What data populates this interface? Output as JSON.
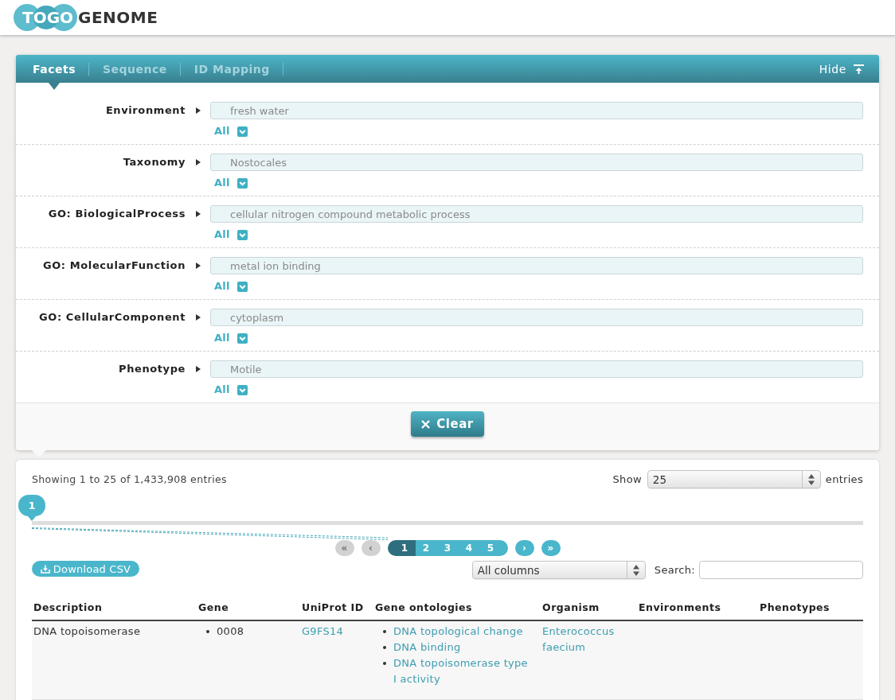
{
  "header": {
    "logo_mark": "TOGO",
    "logo_name": "GENOME"
  },
  "search_panel": {
    "tabs": [
      {
        "label": "Facets",
        "selected": true
      },
      {
        "label": "Sequence",
        "selected": false
      },
      {
        "label": "ID Mapping",
        "selected": false
      }
    ],
    "hide_button": "Hide",
    "facets": [
      {
        "label": "Environment",
        "placeholder": "fresh water",
        "filter": "All"
      },
      {
        "label": "Taxonomy",
        "placeholder": "Nostocales",
        "filter": "All"
      },
      {
        "label": "GO: BiologicalProcess",
        "placeholder": "cellular nitrogen compound metabolic process",
        "filter": "All"
      },
      {
        "label": "GO: MolecularFunction",
        "placeholder": "metal ion binding",
        "filter": "All"
      },
      {
        "label": "GO: CellularComponent",
        "placeholder": "cytoplasm",
        "filter": "All"
      },
      {
        "label": "Phenotype",
        "placeholder": "Motile",
        "filter": "All"
      }
    ],
    "clear_button": "Clear"
  },
  "results": {
    "summary": "Showing 1 to 25 of 1,433,908 entries",
    "show_label": "Show",
    "page_size": "25",
    "entries_label": "entries",
    "page_slider": {
      "handle": "1",
      "level": 0
    },
    "pagination": {
      "first": {
        "label": "«",
        "disabled": true
      },
      "previous": {
        "label": "‹",
        "disabled": true
      },
      "pages": [
        {
          "label": "1",
          "selected": true
        },
        {
          "label": "2",
          "selected": false
        },
        {
          "label": "3",
          "selected": false
        },
        {
          "label": "4",
          "selected": false
        },
        {
          "label": "5",
          "selected": false
        }
      ],
      "next": {
        "label": "›",
        "disabled": false
      },
      "last": {
        "label": "»",
        "disabled": false
      }
    },
    "download_button": "Download CSV",
    "column_filter": "All columns",
    "search_label": "Search:",
    "table": {
      "columns": [
        "Description",
        "Gene",
        "UniProt ID",
        "Gene ontologies",
        "Organism",
        "Environments",
        "Phenotypes"
      ],
      "rows": [
        {
          "description": "DNA topoisomerase",
          "genes": [
            "0008"
          ],
          "uniprot_id": "G9FS14",
          "gene_ontologies": [
            "DNA topological change",
            "DNA binding",
            "DNA topoisomerase type I activity"
          ],
          "organism": "Enterococcus faecium"
        }
      ]
    }
  }
}
